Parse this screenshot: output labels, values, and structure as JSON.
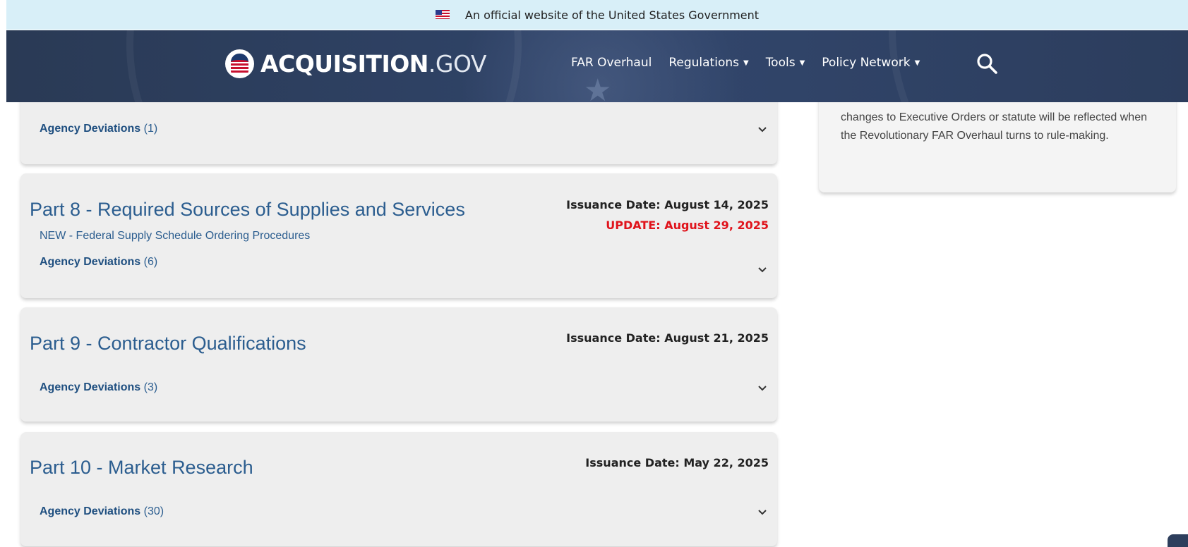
{
  "gov_banner": {
    "text": "An official website of the United States Government"
  },
  "header": {
    "logo_bold": "ACQUISITION",
    "logo_light": ".GOV",
    "nav": [
      {
        "label": "FAR Overhaul",
        "dropdown": false
      },
      {
        "label": "Regulations",
        "dropdown": true
      },
      {
        "label": "Tools",
        "dropdown": true
      },
      {
        "label": "Policy Network",
        "dropdown": true
      }
    ]
  },
  "sidebar": {
    "text": "changes to Executive Orders or statute will be reflected when the Revolutionary FAR Overhaul turns to rule-making."
  },
  "parts": [
    {
      "title": "",
      "deviations_label": "Agency Deviations",
      "deviations_count": "(1)"
    },
    {
      "title": "Part 8 - Required Sources of Supplies and Services",
      "issuance": "Issuance Date: August 14, 2025",
      "update": "UPDATE: August 29, 2025",
      "new_prefix": "NEW - ",
      "new_link": "Federal Supply Schedule Ordering Procedures",
      "deviations_label": "Agency Deviations",
      "deviations_count": "(6)"
    },
    {
      "title": "Part 9 - Contractor Qualifications",
      "issuance": "Issuance Date: August 21, 2025",
      "deviations_label": "Agency Deviations",
      "deviations_count": "(3)"
    },
    {
      "title": "Part 10 - Market Research",
      "issuance": "Issuance Date: May 22, 2025",
      "deviations_label": "Agency Deviations",
      "deviations_count": "(30)"
    }
  ],
  "colors": {
    "accent_link": "#2b5d8f",
    "update_red": "#e0131b",
    "header_bg": "#2e4163",
    "banner_bg": "#d8eff8"
  },
  "icons": {
    "search": "search-icon",
    "chevron": "chevron-down-icon",
    "flag": "us-flag-icon"
  }
}
